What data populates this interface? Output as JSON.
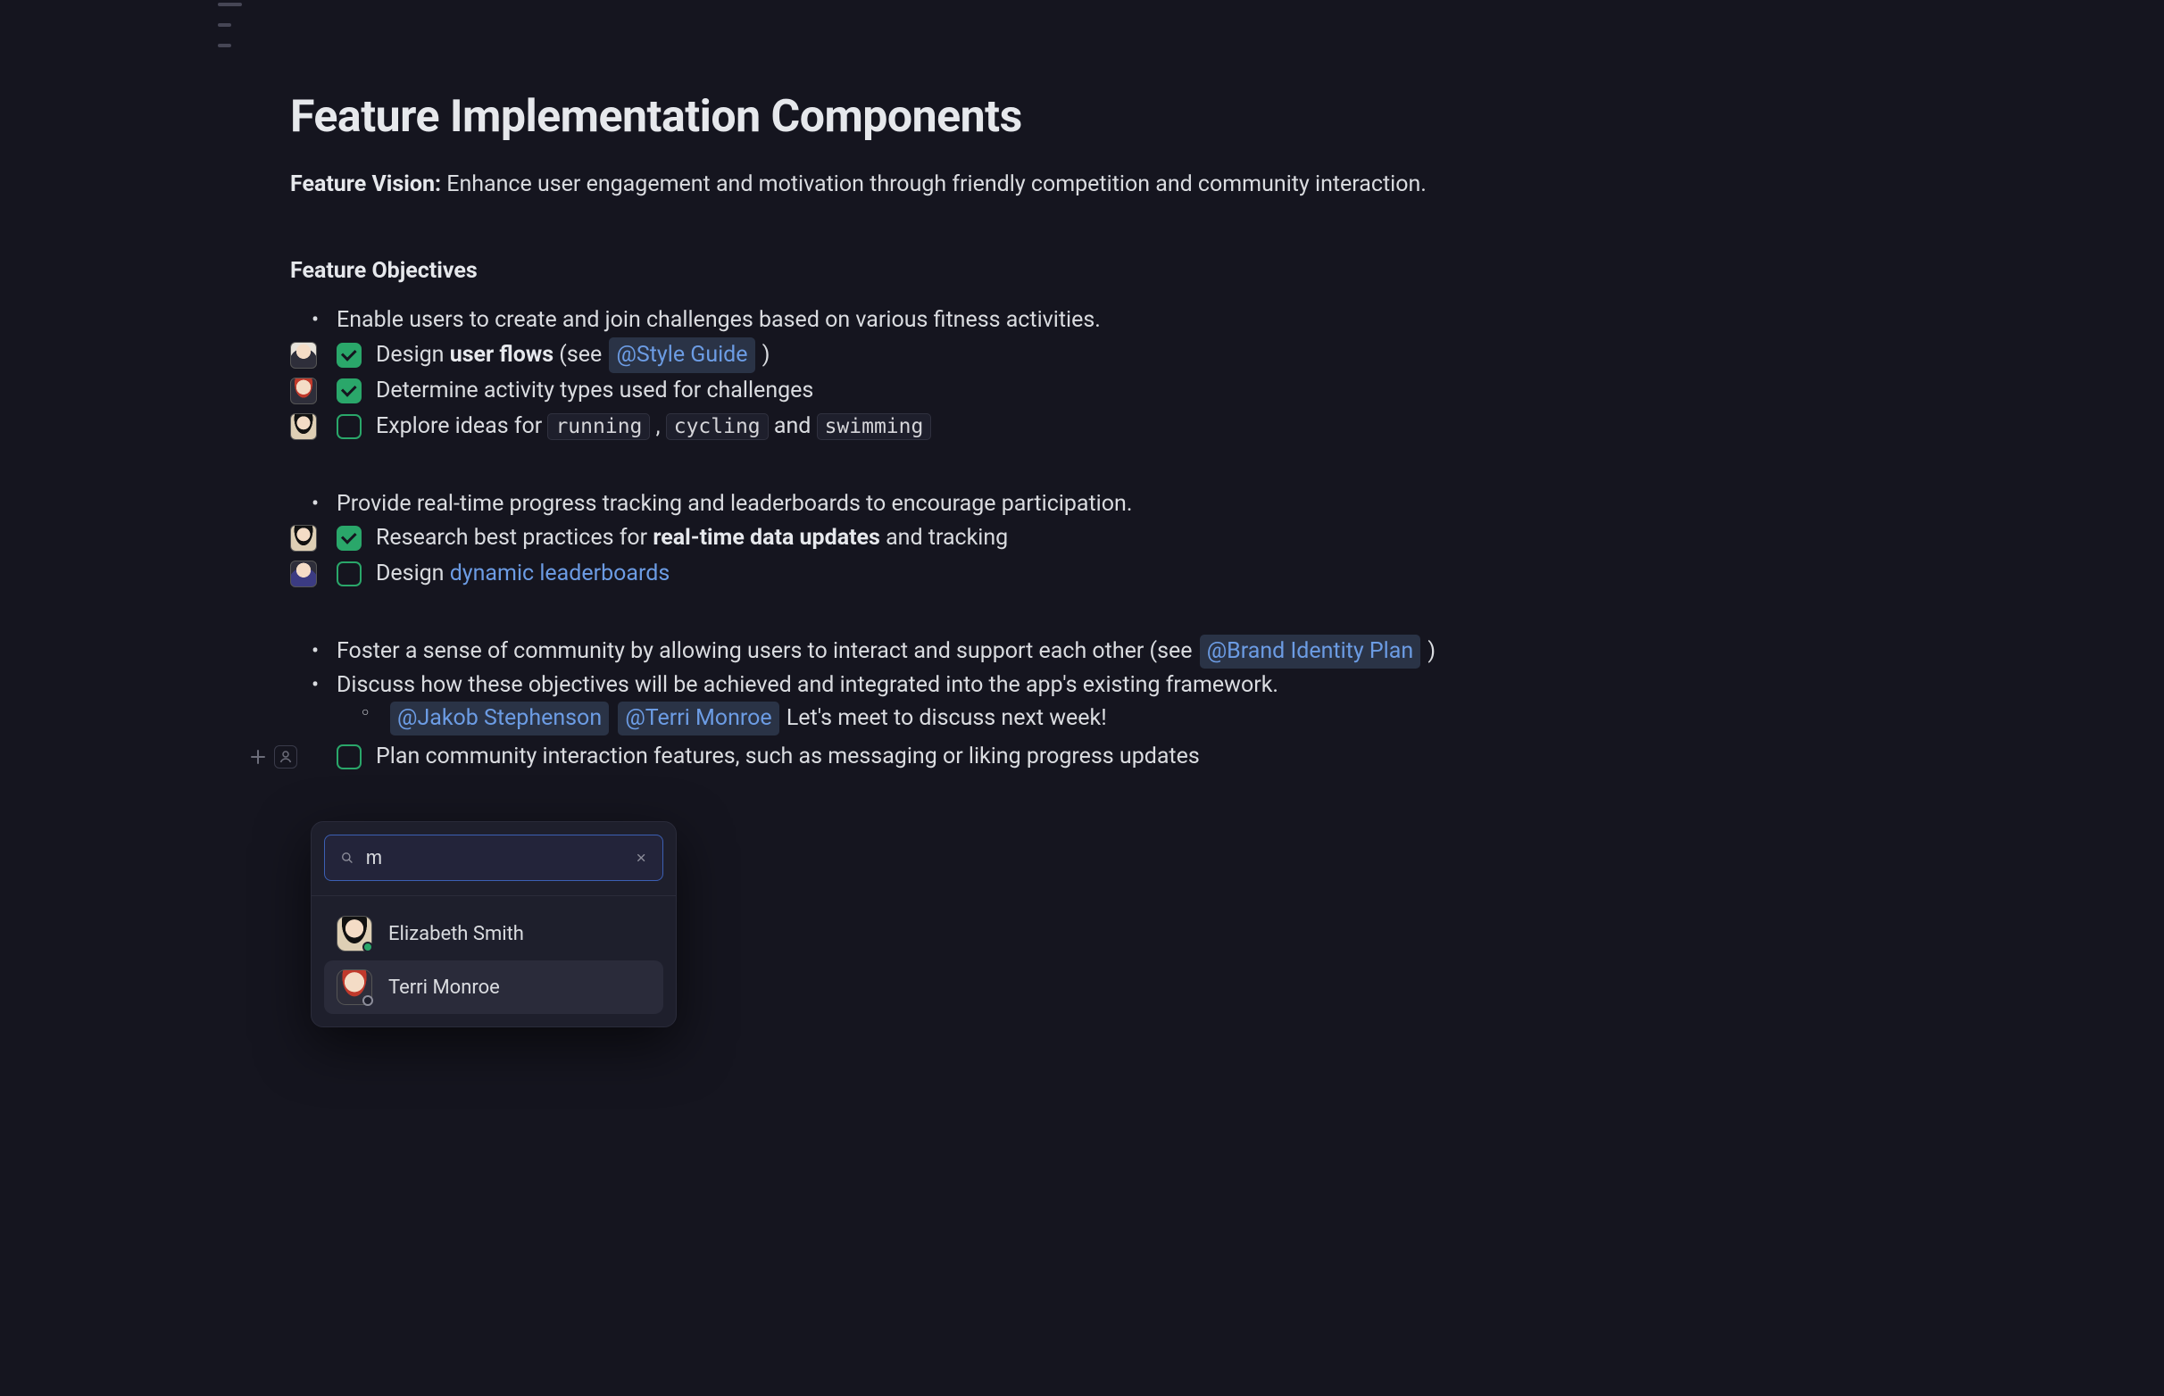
{
  "page_title": "Feature Implementation Components",
  "vision_label": "Feature Vision:",
  "vision_text": " Enhance user engagement and motivation through friendly competition and community interaction.",
  "objectives_heading": "Feature Objectives",
  "bullet1": "Enable users to create and join challenges based on various fitness activities.",
  "tasks1": {
    "t1_pre": "Design ",
    "t1_strong": "user flows",
    "t1_post": " (see ",
    "t1_mention": "@Style Guide",
    "t1_close": " )",
    "t2": "Determine activity types used for challenges",
    "t3_pre": "Explore ideas for ",
    "t3_chip1": "running",
    "t3_sep1": " , ",
    "t3_chip2": "cycling",
    "t3_sep2": " and ",
    "t3_chip3": "swimming"
  },
  "bullet2": "Provide real-time progress tracking and leaderboards to encourage participation.",
  "tasks2": {
    "t1_pre": "Research best practices for ",
    "t1_strong": "real-time data updates",
    "t1_post": " and tracking",
    "t2_pre": "Design ",
    "t2_link": "dynamic leaderboards"
  },
  "bullet3_pre": "Foster a sense of community by allowing users to interact and support each other (see ",
  "bullet3_mention": "@Brand Identity Plan",
  "bullet3_post": "  )",
  "bullet4": "Discuss how these objectives will be achieved and integrated into the app's existing framework.",
  "sub_mention1": "@Jakob Stephenson",
  "sub_mention2": "@Terri Monroe",
  "sub_text": " Let's meet to discuss next week!",
  "task_last": "Plan community interaction features, such as messaging or liking progress updates",
  "popover": {
    "search_value": "m",
    "people": [
      {
        "name": "Elizabeth Smith",
        "status": "online"
      },
      {
        "name": "Terri Monroe",
        "status": "offline"
      }
    ]
  }
}
